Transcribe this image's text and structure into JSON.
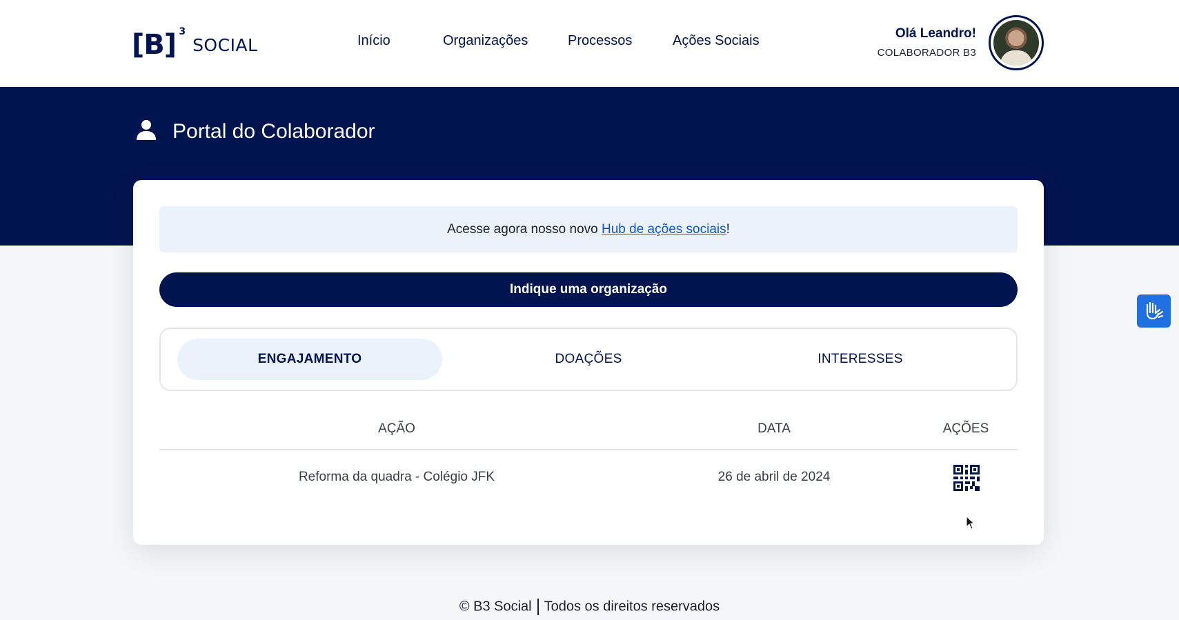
{
  "header": {
    "logo_mark": "[B]",
    "logo_sup": "3",
    "logo_text": "SOCIAL",
    "nav": [
      {
        "label": "Início"
      },
      {
        "label": "Organizações"
      },
      {
        "label": "Processos"
      },
      {
        "label": "Ações Sociais"
      }
    ],
    "user": {
      "greeting": "Olá Leandro!",
      "role": "COLABORADOR B3"
    }
  },
  "hero": {
    "title": "Portal do Colaborador"
  },
  "notice": {
    "prefix": "Acesse agora nosso novo ",
    "link": "Hub de ações sociais",
    "suffix": "!"
  },
  "cta": {
    "label": "Indique uma organização"
  },
  "tabs": [
    {
      "label": "ENGAJAMENTO",
      "active": true
    },
    {
      "label": "DOAÇÕES",
      "active": false
    },
    {
      "label": "INTERESSES",
      "active": false
    }
  ],
  "table": {
    "columns": [
      "AÇÃO",
      "DATA",
      "AÇÕES"
    ],
    "rows": [
      {
        "acao": "Reforma da quadra - Colégio JFK",
        "data": "26 de abril de 2024",
        "acoes_icon": "qr-code-icon"
      }
    ]
  },
  "accessibility": {
    "icon": "sign-language-icon"
  },
  "footer": {
    "left": "© B3 Social",
    "right": "Todos os direitos reservados"
  },
  "colors": {
    "brand_navy": "#001450",
    "light_blue": "#ebf2fc",
    "link_blue": "#1456c8",
    "access_blue": "#1f6fe0"
  }
}
